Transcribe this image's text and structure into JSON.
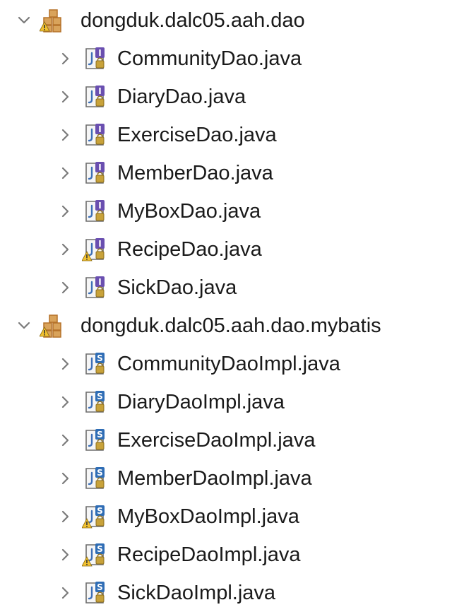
{
  "packages": [
    {
      "name": "dongduk.dalc05.aah.dao",
      "expanded": true,
      "icon": "package-icon",
      "warning": true,
      "files": [
        {
          "name": "CommunityDao.java",
          "kind": "interface",
          "warning": false
        },
        {
          "name": "DiaryDao.java",
          "kind": "interface",
          "warning": false
        },
        {
          "name": "ExerciseDao.java",
          "kind": "interface",
          "warning": false
        },
        {
          "name": "MemberDao.java",
          "kind": "interface",
          "warning": false
        },
        {
          "name": "MyBoxDao.java",
          "kind": "interface",
          "warning": false
        },
        {
          "name": "RecipeDao.java",
          "kind": "interface",
          "warning": true
        },
        {
          "name": "SickDao.java",
          "kind": "interface",
          "warning": false
        }
      ]
    },
    {
      "name": "dongduk.dalc05.aah.dao.mybatis",
      "expanded": true,
      "icon": "package-icon",
      "warning": true,
      "files": [
        {
          "name": "CommunityDaoImpl.java",
          "kind": "class",
          "warning": false
        },
        {
          "name": "DiaryDaoImpl.java",
          "kind": "class",
          "warning": false
        },
        {
          "name": "ExerciseDaoImpl.java",
          "kind": "class",
          "warning": false
        },
        {
          "name": "MemberDaoImpl.java",
          "kind": "class",
          "warning": false
        },
        {
          "name": "MyBoxDaoImpl.java",
          "kind": "class",
          "warning": true
        },
        {
          "name": "RecipeDaoImpl.java",
          "kind": "class",
          "warning": true
        },
        {
          "name": "SickDaoImpl.java",
          "kind": "class",
          "warning": false
        }
      ]
    }
  ],
  "colors": {
    "twisty": "#7a7a7a",
    "interface_badge": "#6a4fb0",
    "class_badge": "#2f6db5",
    "package_brown": "#b5722a",
    "warning_yellow": "#f2c230",
    "lock_gold": "#c8a23a"
  }
}
